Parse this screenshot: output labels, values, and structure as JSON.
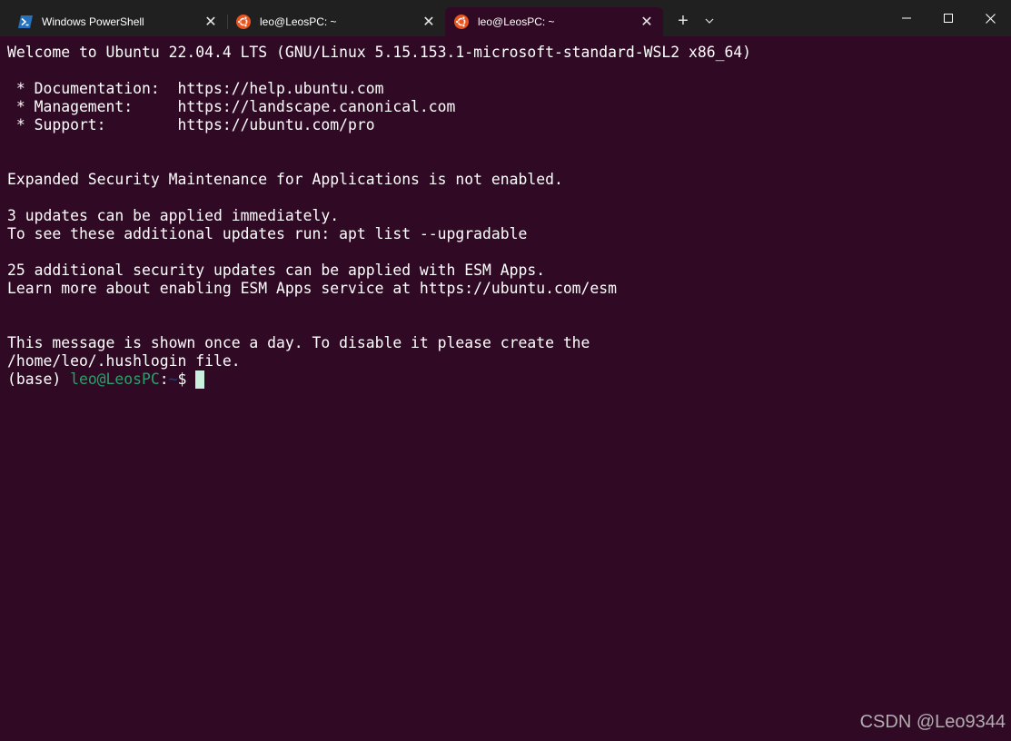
{
  "tabs": [
    {
      "label": "Windows PowerShell",
      "icon": "powershell-icon",
      "active": false
    },
    {
      "label": "leo@LeosPC: ~",
      "icon": "ubuntu-icon",
      "active": false
    },
    {
      "label": "leo@LeosPC: ~",
      "icon": "ubuntu-icon",
      "active": true
    }
  ],
  "tab_close_glyph": "✕",
  "new_tab_glyph": "+",
  "dropdown_glyph": "⌄",
  "terminal": {
    "lines": [
      "Welcome to Ubuntu 22.04.4 LTS (GNU/Linux 5.15.153.1-microsoft-standard-WSL2 x86_64)",
      "",
      " * Documentation:  https://help.ubuntu.com",
      " * Management:     https://landscape.canonical.com",
      " * Support:        https://ubuntu.com/pro",
      "",
      "",
      "Expanded Security Maintenance for Applications is not enabled.",
      "",
      "3 updates can be applied immediately.",
      "To see these additional updates run: apt list --upgradable",
      "",
      "25 additional security updates can be applied with ESM Apps.",
      "Learn more about enabling ESM Apps service at https://ubuntu.com/esm",
      "",
      "",
      "This message is shown once a day. To disable it please create the",
      "/home/leo/.hushlogin file."
    ],
    "prompt": {
      "env": "(base) ",
      "user_host": "leo@LeosPC",
      "colon": ":",
      "path": "~",
      "symbol": "$ "
    }
  },
  "watermark": "CSDN @Leo9344",
  "colors": {
    "terminal_bg": "#300a24",
    "tabbar_bg": "#202020",
    "prompt_user": "#26a269",
    "prompt_path": "#12488b",
    "ubuntu_orange": "#e95420",
    "powershell_blue": "#2671be"
  }
}
